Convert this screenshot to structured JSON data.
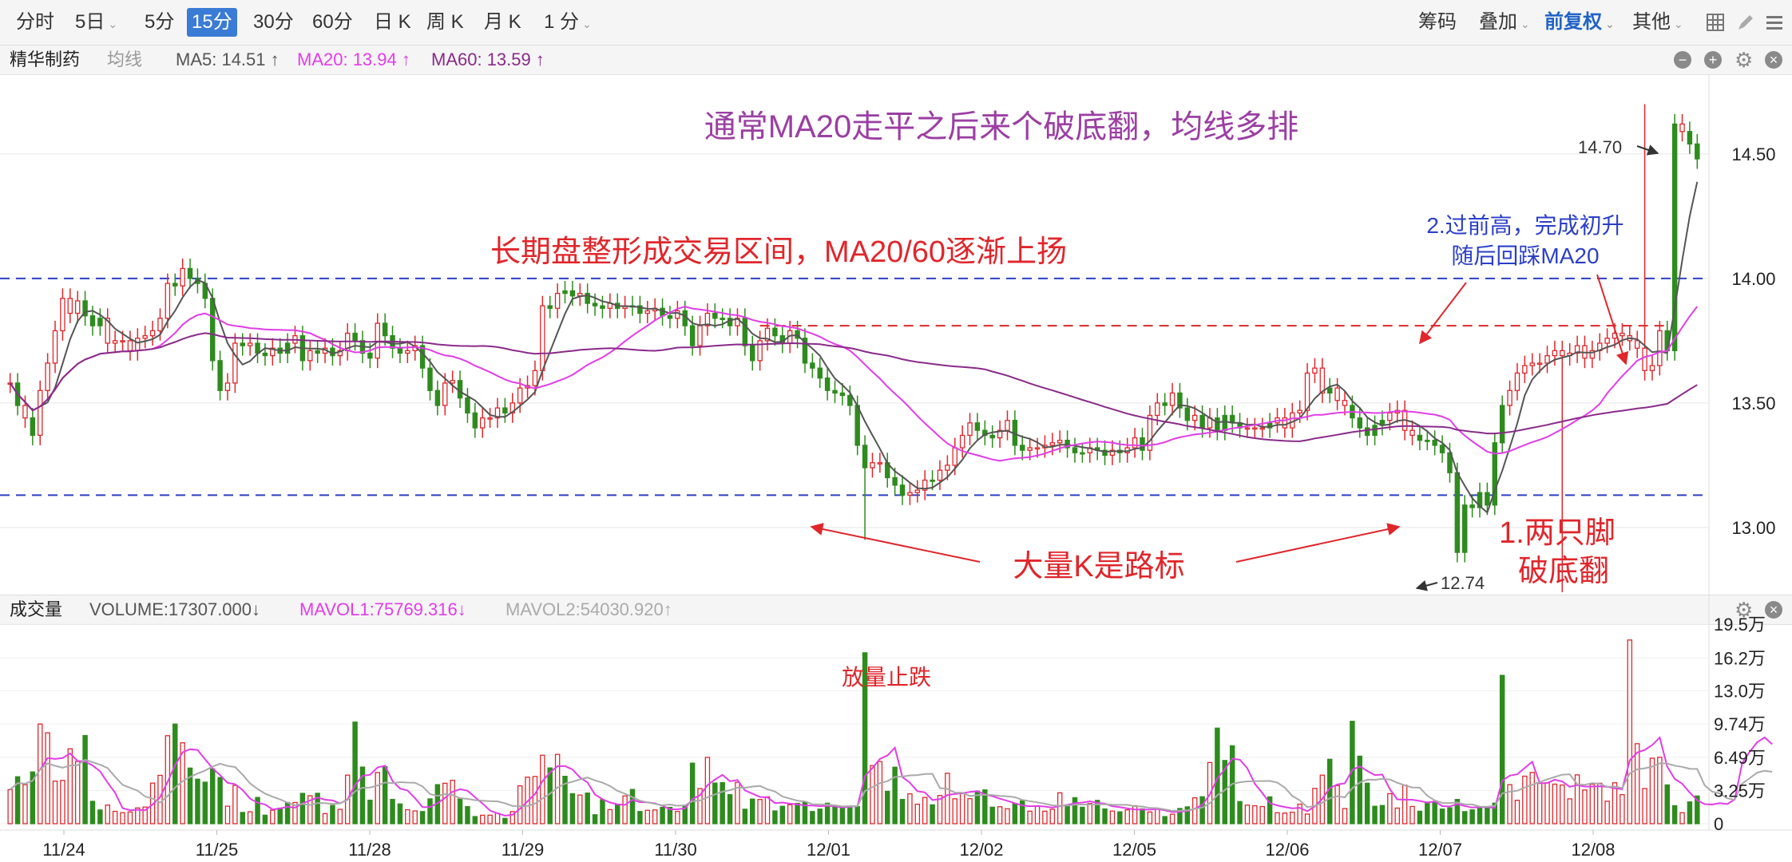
{
  "toolbar": {
    "periods": [
      "分时",
      "5日",
      "5分",
      "15分",
      "30分",
      "60分",
      "日 K",
      "周 K",
      "月 K",
      "1 分"
    ],
    "active_period": "15分",
    "right_items": [
      "筹码",
      "叠加",
      "前复权",
      "其他"
    ]
  },
  "stock_bar": {
    "name": "精华制药",
    "avg_line": "均线",
    "ma5": "MA5: 14.51 ↑",
    "ma20": "MA20: 13.94 ↑",
    "ma60": "MA60: 13.59 ↑"
  },
  "volume_bar": {
    "label": "成交量",
    "volume": "VOLUME:17307.000↓",
    "mavol1": "MAVOL1:75769.316↓",
    "mavol2": "MAVOL2:54030.920↑"
  },
  "colors": {
    "up": "#e0262b",
    "down": "#2e8b1e",
    "ma5": "#555555",
    "ma20": "#e23de8",
    "ma60": "#8a2a8a",
    "mavol1": "#e23de8",
    "mavol2": "#aaaaaa",
    "annotation_red": "#e0262b",
    "annotation_purple": "#9b3fa3",
    "annotation_blue": "#2b3fc7",
    "active_tab": "#3a7bd5"
  },
  "icons": [
    "minus-circle-icon",
    "plus-circle-icon",
    "gear-icon",
    "close-circle-icon",
    "grid-icon",
    "pen-icon",
    "menu-icon"
  ],
  "annotations": {
    "title": "通常MA20走平之后来个破底翻，均线多排",
    "range_note": "长期盘整形成交易区间，MA20/60逐渐上扬",
    "big_k": "大量K是路标",
    "break_line1": "1.两只脚",
    "break_line2": "破底翻",
    "new_high_line1": "2.过前高，完成初升",
    "new_high_line2": "随后回踩MA20",
    "volume_note": "放量止跌",
    "high_label": "14.70",
    "low_label": "12.74"
  },
  "chart_data": [
    {
      "type": "candlestick",
      "title": "",
      "ylim": [
        12.74,
        14.82
      ],
      "y_ticks": [
        "14.50",
        "14.00",
        "13.50",
        "13.00"
      ],
      "x_ticks": [
        "11/24",
        "11/25",
        "11/28",
        "11/29",
        "11/30",
        "12/01",
        "12/02",
        "12/05",
        "12/06",
        "12/07",
        "12/08"
      ],
      "reference_lines": {
        "upper_range": 14.0,
        "lower_range": 13.13,
        "prior_high": 13.81
      },
      "high": 14.7,
      "low": 12.74,
      "close": [
        13.58,
        13.49,
        13.44,
        13.37,
        13.55,
        13.66,
        13.79,
        13.92,
        13.86,
        13.91,
        13.85,
        13.81,
        13.84,
        13.74,
        13.75,
        13.75,
        13.71,
        13.76,
        13.77,
        13.79,
        13.84,
        13.98,
        13.97,
        14.04,
        14.0,
        13.98,
        13.92,
        13.67,
        13.55,
        13.58,
        13.74,
        13.73,
        13.74,
        13.7,
        13.69,
        13.72,
        13.7,
        13.74,
        13.77,
        13.67,
        13.71,
        13.7,
        13.72,
        13.69,
        13.71,
        13.78,
        13.75,
        13.7,
        13.68,
        13.82,
        13.77,
        13.72,
        13.7,
        13.71,
        13.73,
        13.64,
        13.55,
        13.49,
        13.58,
        13.59,
        13.52,
        13.46,
        13.4,
        13.44,
        13.44,
        13.48,
        13.46,
        13.5,
        13.56,
        13.57,
        13.63,
        13.89,
        13.88,
        13.94,
        13.95,
        13.93,
        13.94,
        13.9,
        13.89,
        13.88,
        13.9,
        13.88,
        13.89,
        13.89,
        13.86,
        13.87,
        13.88,
        13.85,
        13.84,
        13.87,
        13.81,
        13.73,
        13.81,
        13.86,
        13.84,
        13.84,
        13.81,
        13.84,
        13.73,
        13.67,
        13.75,
        13.8,
        13.77,
        13.74,
        13.79,
        13.76,
        13.66,
        13.64,
        13.6,
        13.55,
        13.54,
        13.53,
        13.49,
        13.33,
        13.24,
        13.26,
        13.26,
        13.2,
        13.17,
        13.13,
        13.14,
        13.15,
        13.19,
        13.19,
        13.23,
        13.25,
        13.32,
        13.37,
        13.42,
        13.39,
        13.37,
        13.36,
        13.39,
        13.43,
        13.33,
        13.31,
        13.32,
        13.32,
        13.33,
        13.34,
        13.35,
        13.32,
        13.3,
        13.3,
        13.32,
        13.31,
        13.29,
        13.31,
        13.3,
        13.32,
        13.36,
        13.31,
        13.45,
        13.5,
        13.49,
        13.54,
        13.48,
        13.43,
        13.45,
        13.4,
        13.44,
        13.39,
        13.45,
        13.42,
        13.4,
        13.4,
        13.4,
        13.4,
        13.42,
        13.44,
        13.4,
        13.46,
        13.47,
        13.62,
        13.64,
        13.54,
        13.56,
        13.51,
        13.49,
        13.44,
        13.4,
        13.37,
        13.41,
        13.43,
        13.46,
        13.47,
        13.39,
        13.37,
        13.35,
        13.35,
        13.33,
        13.3,
        13.22,
        12.9,
        13.09,
        13.08,
        13.14,
        13.09,
        13.34,
        13.49,
        13.55,
        13.62,
        13.65,
        13.66,
        13.66,
        13.69,
        13.71,
        13.69,
        13.7,
        13.73,
        13.68,
        13.71,
        13.74,
        13.76,
        13.78,
        13.77,
        13.75,
        13.72,
        13.63,
        13.65,
        13.79,
        13.71,
        14.62,
        14.59,
        14.54,
        14.48
      ]
    },
    {
      "type": "bar",
      "title": "",
      "y_ticks": [
        "19.5万",
        "16.2万",
        "13.0万",
        "9.74万",
        "6.49万",
        "3.25万",
        "0"
      ],
      "ylim": [
        0,
        195000
      ],
      "x_ticks": [
        "11/24",
        "11/25",
        "11/28",
        "11/29",
        "11/30",
        "12/01",
        "12/02",
        "12/05",
        "12/06",
        "12/07",
        "12/08"
      ],
      "volume": [
        33280,
        45870,
        38080,
        50560,
        97400,
        88810,
        41580,
        42240,
        73190,
        60800,
        86150,
        21850,
        13400,
        18190,
        12050,
        10740,
        11490,
        15360,
        16250,
        39650,
        47230,
        85970,
        97350,
        79040,
        54350,
        43480,
        40570,
        53490,
        45100,
        17050,
        37400,
        11000,
        11650,
        25640,
        8300,
        13170,
        15180,
        20710,
        20720,
        29640,
        27280,
        29680,
        9850,
        17840,
        14050,
        47460,
        99300,
        55320,
        22940,
        50000,
        55770,
        23700,
        19280,
        13670,
        12440,
        11870,
        24230,
        38120,
        39500,
        42410,
        24160,
        16690,
        6970,
        8250,
        8290,
        10170,
        5180,
        11810,
        37000,
        45470,
        46120,
        66890,
        54480,
        67740,
        46290,
        29340,
        27990,
        29940,
        8770,
        23330,
        13760,
        18890,
        27150,
        33450,
        11940,
        13070,
        13420,
        15890,
        15930,
        12000,
        17630,
        59170,
        34300,
        64830,
        39700,
        40130,
        28360,
        40450,
        14140,
        24060,
        23630,
        26240,
        12460,
        17010,
        18540,
        19830,
        21370,
        11900,
        14250,
        20010,
        17740,
        15440,
        15330,
        16730,
        167000,
        56780,
        60750,
        31610,
        55200,
        23690,
        29170,
        19040,
        25660,
        18420,
        27550,
        49310,
        24340,
        29410,
        24430,
        31770,
        33000,
        16100,
        16590,
        14590,
        19630,
        22290,
        12240,
        17500,
        12250,
        14060,
        30170,
        17790,
        25420,
        16070,
        19710,
        22770,
        14400,
        12330,
        11590,
        13490,
        17540,
        14480,
        11430,
        14720,
        6950,
        9250,
        14860,
        16440,
        25290,
        26320,
        59780,
        93380,
        61760,
        76130,
        21640,
        18190,
        17540,
        16750,
        26220,
        10690,
        10410,
        11210,
        19130,
        9370,
        34490,
        47440,
        62950,
        37220,
        14770,
        100050,
        65970,
        39550,
        17010,
        17760,
        29330,
        15260,
        37700,
        16830,
        12190,
        21120,
        21270,
        14270,
        15500,
        23680,
        11790,
        13510,
        16510,
        15250,
        20050,
        144950,
        38150,
        22890,
        46430,
        50060,
        39670,
        39980,
        38640,
        37810,
        24260,
        47670,
        32960,
        38610,
        39460,
        21970,
        39980,
        28370,
        179510,
        78170,
        34360,
        63990,
        64880,
        37890,
        17580,
        10760,
        21270,
        27060,
        18740,
        15910,
        17260,
        16400,
        50830,
        194730,
        71750,
        64350,
        40060,
        17310
      ],
      "up": [
        1,
        0,
        1,
        0,
        1,
        1,
        1,
        1,
        1,
        1,
        0,
        0,
        0,
        1,
        1,
        1,
        1,
        1,
        1,
        1,
        1,
        1,
        0,
        1,
        0,
        0,
        0,
        0,
        0,
        1,
        1,
        0,
        1,
        0,
        0,
        1,
        0,
        0,
        1,
        0,
        1,
        0,
        1,
        0,
        1,
        1,
        0,
        0,
        0,
        1,
        0,
        0,
        0,
        1,
        1,
        0,
        0,
        0,
        1,
        1,
        0,
        0,
        0,
        1,
        1,
        1,
        0,
        1,
        1,
        1,
        1,
        1,
        0,
        1,
        0,
        0,
        1,
        0,
        0,
        0,
        1,
        0,
        1,
        0,
        0,
        1,
        1,
        0,
        0,
        1,
        0,
        0,
        1,
        1,
        0,
        0,
        0,
        1,
        0,
        0,
        1,
        1,
        0,
        0,
        1,
        0,
        0,
        0,
        0,
        0,
        0,
        0,
        0,
        0,
        0,
        1,
        1,
        0,
        0,
        0,
        1,
        1,
        1,
        0,
        1,
        1,
        1,
        1,
        1,
        0,
        0,
        0,
        1,
        1,
        0,
        0,
        1,
        1,
        1,
        1,
        1,
        0,
        0,
        0,
        1,
        0,
        0,
        1,
        0,
        1,
        1,
        0,
        1,
        1,
        0,
        1,
        0,
        0,
        1,
        0,
        1,
        0,
        0,
        0,
        0,
        1,
        1,
        1,
        0,
        1,
        1,
        1,
        1,
        1,
        1,
        1,
        0,
        1,
        1,
        0,
        0,
        0,
        0,
        0,
        1,
        1,
        1,
        1,
        0,
        0,
        0,
        0,
        0,
        0,
        0,
        0,
        0,
        0,
        0,
        0,
        1,
        1,
        1,
        1,
        1,
        1,
        1,
        1,
        1,
        1,
        1,
        1,
        1,
        1,
        1,
        1,
        1,
        1,
        1,
        1,
        1,
        0,
        0,
        1,
        0,
        0,
        1,
        0,
        1,
        0,
        1,
        1,
        1,
        1,
        0,
        0,
        0,
        0,
        0
      ]
    }
  ]
}
